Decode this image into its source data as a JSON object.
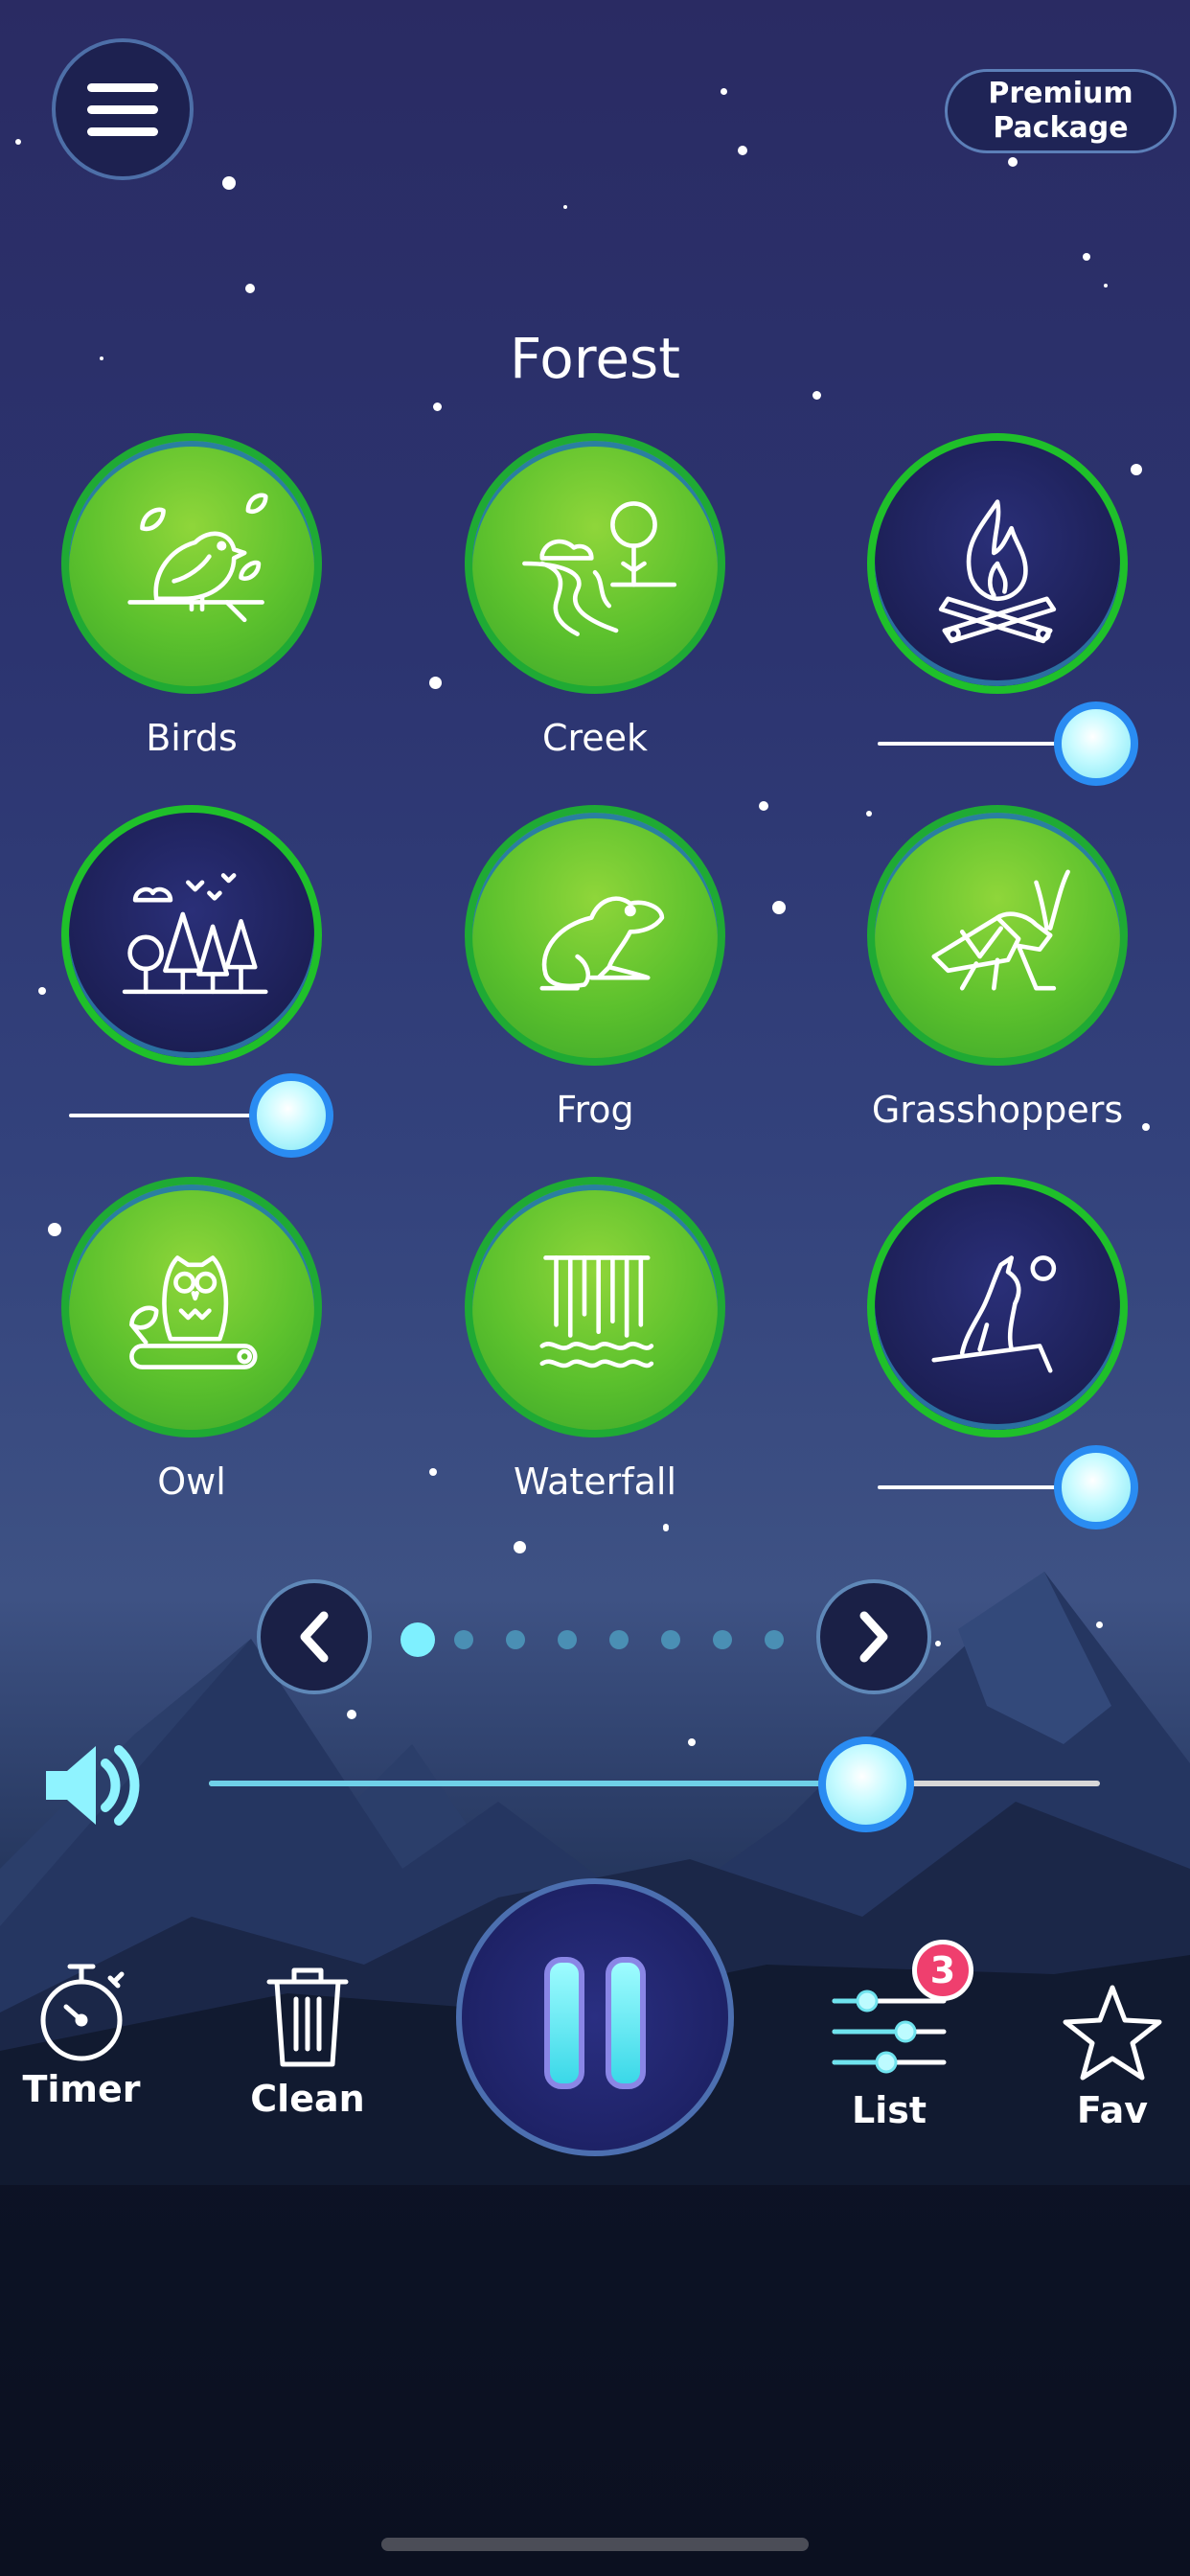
{
  "header": {
    "menu_icon": "hamburger-menu-icon",
    "premium_label": "Premium\nPackage"
  },
  "category_title": "Forest",
  "sounds": [
    {
      "id": "birds",
      "label": "Birds",
      "active": false,
      "icon": "bird-icon"
    },
    {
      "id": "creek",
      "label": "Creek",
      "active": false,
      "icon": "creek-icon"
    },
    {
      "id": "campfire",
      "label": "",
      "active": true,
      "icon": "campfire-icon",
      "volume": 0.9
    },
    {
      "id": "forest",
      "label": "",
      "active": true,
      "icon": "trees-icon",
      "volume": 0.9
    },
    {
      "id": "frog",
      "label": "Frog",
      "active": false,
      "icon": "frog-icon"
    },
    {
      "id": "grasshoppers",
      "label": "Grasshoppers",
      "active": false,
      "icon": "grasshopper-icon"
    },
    {
      "id": "owl",
      "label": "Owl",
      "active": false,
      "icon": "owl-icon"
    },
    {
      "id": "waterfall",
      "label": "Waterfall",
      "active": false,
      "icon": "waterfall-icon"
    },
    {
      "id": "wolf",
      "label": "",
      "active": true,
      "icon": "howling-wolf-icon",
      "volume": 0.9
    }
  ],
  "pagination": {
    "current": 1,
    "total": 8
  },
  "master_volume": {
    "icon": "speaker-icon",
    "value": 0.7
  },
  "bottom_bar": {
    "timer_label": "Timer",
    "clean_label": "Clean",
    "list_label": "List",
    "list_badge": "3",
    "fav_label": "Fav"
  },
  "colors": {
    "active_tile": "#1c1f55",
    "inactive_tile": "#5cc12d",
    "knob_border": "#2a8cf2",
    "badge": "#ef3f6e"
  }
}
